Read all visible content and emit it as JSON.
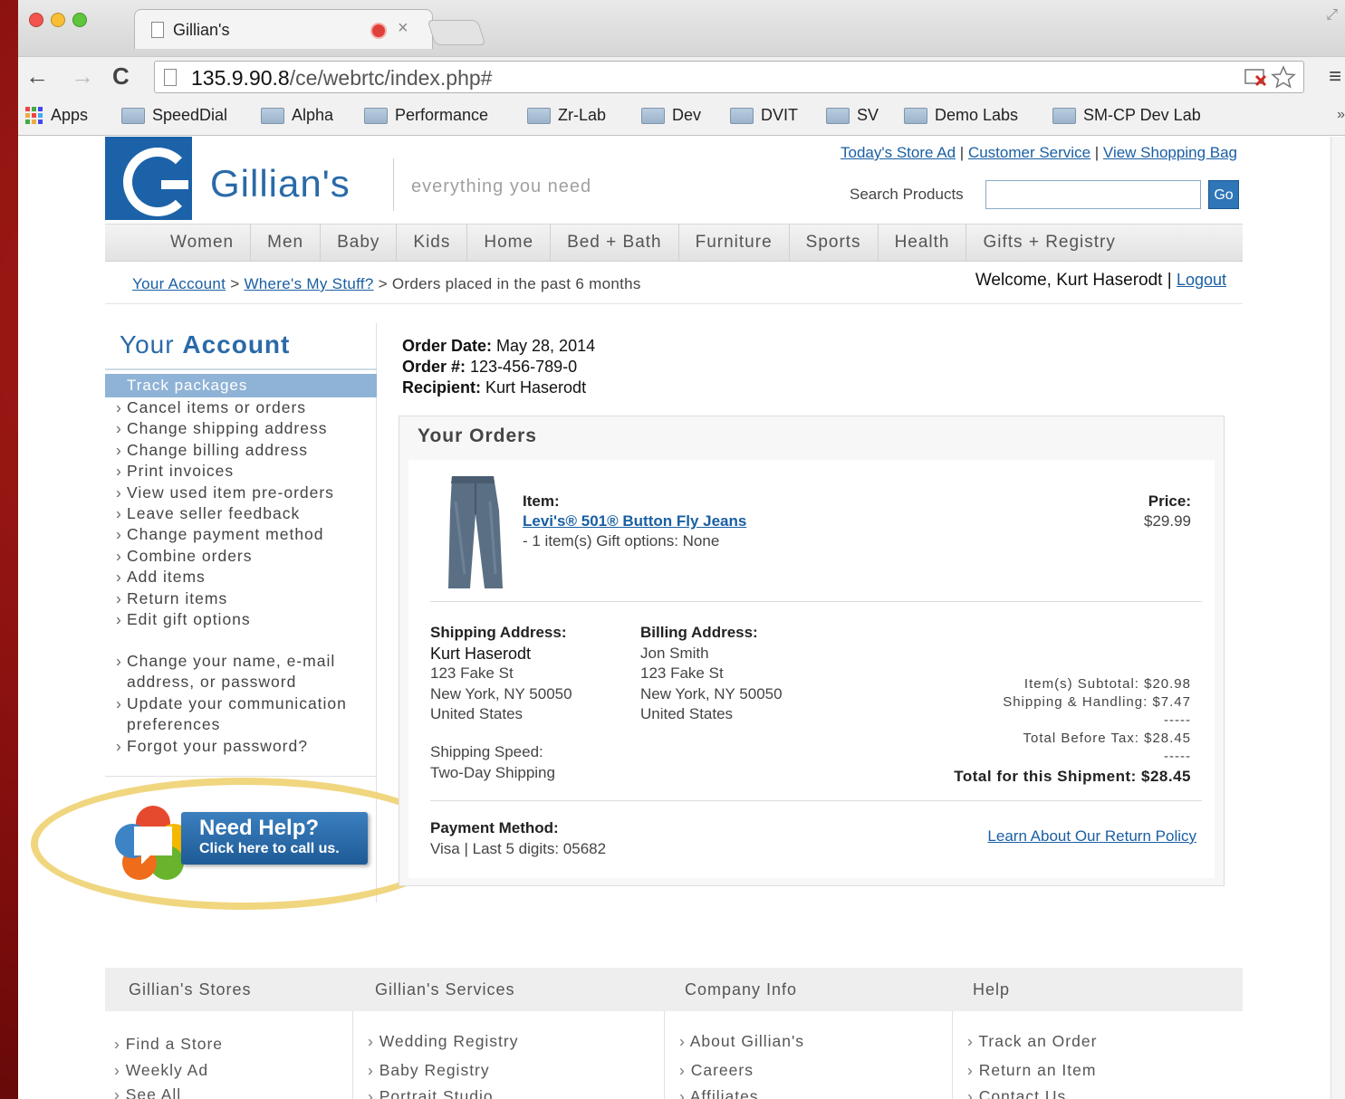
{
  "browser": {
    "tab_title": "Gillian's",
    "url_host": "135.9.90.8",
    "url_path": "/ce/webrtc/index.php#",
    "bookmarks": [
      "Apps",
      "SpeedDial",
      "Alpha",
      "Performance",
      "Zr-Lab",
      "Dev",
      "DVIT",
      "SV",
      "Demo Labs",
      "SM-CP Dev Lab"
    ],
    "bookmarks_more": "»"
  },
  "header": {
    "logo_text": "Gillian's",
    "tagline": "everything you need",
    "links": [
      "Today's Store Ad",
      "Customer Service",
      "View Shopping Bag"
    ],
    "search_label": "Search Products",
    "search_value": "",
    "search_button": "Go"
  },
  "categories": [
    "Women",
    "Men",
    "Baby",
    "Kids",
    "Home",
    "Bed + Bath",
    "Furniture",
    "Sports",
    "Health",
    "Gifts + Registry"
  ],
  "breadcrumb": {
    "link1": "Your Account",
    "sep1": " > ",
    "link2": "Where's My Stuff?",
    "rest": " > Orders placed in the past 6 months"
  },
  "welcome": {
    "text": "Welcome, Kurt Haserodt",
    "sep": " | ",
    "logout": "Logout"
  },
  "sidebar": {
    "title_light": "Your ",
    "title_bold": "Account",
    "active": "Track packages",
    "items": [
      "Cancel items or orders",
      "Change shipping address",
      "Change billing address",
      "Print invoices",
      "View used item pre-orders",
      "Leave seller feedback",
      "Change payment method",
      "Combine orders",
      "Add items",
      "Return items",
      "Edit gift options"
    ],
    "items2": [
      "Change your name, e-mail address, or password",
      "Update your communication preferences",
      "Forgot your password?"
    ],
    "help_title": "Need Help?",
    "help_sub": "Click here to call us."
  },
  "order": {
    "date_label": "Order Date:",
    "date": " May 28, 2014",
    "num_label": "Order #:",
    "num": " 123-456-789-0",
    "recipient_label": "Recipient:",
    "recipient": " Kurt Haserodt",
    "box_title": "Your Orders",
    "item_label": "Item:",
    "item_name": "Levi's® 501® Button Fly Jeans",
    "item_detail": "- 1 item(s) Gift options: None",
    "price_label": "Price:",
    "price": "$29.99",
    "shipping": {
      "label": "Shipping Address:",
      "name": "Kurt Haserodt",
      "line1": "123 Fake St",
      "line2": "New York, NY 50050",
      "line3": "United States"
    },
    "billing": {
      "label": "Billing Address:",
      "name": "Jon Smith",
      "line1": "123 Fake St",
      "line2": "New York, NY 50050",
      "line3": "United States"
    },
    "speed_label": "Shipping Speed:",
    "speed": "Two-Day Shipping",
    "subtotal": "Item(s) Subtotal:  $20.98",
    "shipping_handling": "Shipping & Handling:  $7.47",
    "dashes": "-----",
    "before_tax": "Total Before Tax:  $28.45",
    "grand_total": "Total for this Shipment:  $28.45",
    "payment_label": "Payment Method:",
    "payment": "Visa | Last 5 digits: 05682",
    "return_link": "Learn About Our Return Policy"
  },
  "footer": {
    "headings": [
      "Gillian's Stores",
      "Gillian's Services",
      "Company Info",
      "Help"
    ],
    "col1": [
      "Find a Store",
      "Weekly Ad",
      "See All"
    ],
    "col2": [
      "Wedding Registry",
      "Baby Registry",
      "Portrait Studio"
    ],
    "col3": [
      "About Gillian's",
      "Careers",
      "Affiliates"
    ],
    "col4": [
      "Track an Order",
      "Return an Item",
      "Contact Us"
    ]
  }
}
